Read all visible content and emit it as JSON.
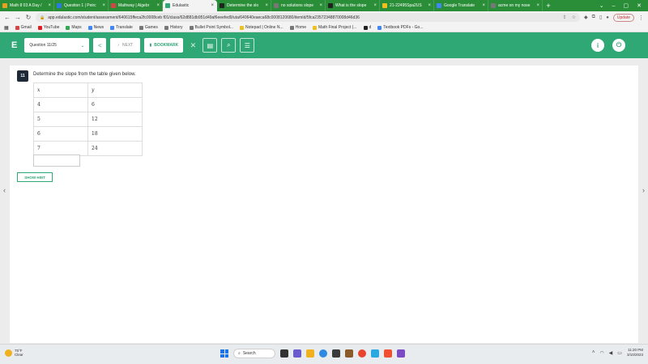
{
  "browser": {
    "tabs": [
      {
        "label": "Math 8 03 A Day /",
        "color": "#e8a020"
      },
      {
        "label": "Question 1 | Peirc",
        "color": "#2a7ae2"
      },
      {
        "label": "Mathway | Algebr",
        "color": "#d64545"
      },
      {
        "label": "Edulastic",
        "color": "#30a876"
      },
      {
        "label": "Determine the slo",
        "color": "#222222"
      },
      {
        "label": "no solutions slope",
        "color": "#777777"
      },
      {
        "label": "What is the slope",
        "color": "#222222"
      },
      {
        "label": "21-22495Spa2US",
        "color": "#f0c020"
      },
      {
        "label": "Google Translate",
        "color": "#4285f4"
      },
      {
        "label": "acme on my nose",
        "color": "#777777"
      }
    ],
    "new_tab": "+",
    "url": "app.edulastic.com/student/assessment/640615ffeca2fc0008ceb f01/class/62d881db951d49af6eeefed9/uta/640640eaeca68c0008120680/itemId/5fca23572348870008d46d36",
    "update_label": "Update",
    "bookmarks": [
      {
        "label": "Gmail",
        "color": "#d64545"
      },
      {
        "label": "YouTube",
        "color": "#e02020"
      },
      {
        "label": "Maps",
        "color": "#34a853"
      },
      {
        "label": "News",
        "color": "#4285f4"
      },
      {
        "label": "Translate",
        "color": "#4285f4"
      },
      {
        "label": "Games",
        "color": "#777777"
      },
      {
        "label": "History",
        "color": "#777777"
      },
      {
        "label": "Bullet Point Symbol...",
        "color": "#777777"
      },
      {
        "label": "Notepad | Online N...",
        "color": "#f0c020"
      },
      {
        "label": "Home",
        "color": "#777777"
      },
      {
        "label": "Math Final Project (...",
        "color": "#f0c020"
      },
      {
        "label": "d",
        "color": "#222222"
      },
      {
        "label": "Textbook PDFs - Go...",
        "color": "#4285f4"
      }
    ]
  },
  "header": {
    "logo": "E",
    "question_select": "Question 11/25",
    "prev_label": "<",
    "next_label": "NEXT",
    "bookmark_label": "BOOKMARK",
    "accent": "#30a876"
  },
  "question": {
    "number": "11",
    "prompt": "Determine the slope from the table given below.",
    "table": {
      "headers": [
        "x",
        "y"
      ],
      "rows": [
        [
          "4",
          "6"
        ],
        [
          "5",
          "12"
        ],
        [
          "6",
          "18"
        ],
        [
          "7",
          "24"
        ]
      ]
    },
    "answer_value": "",
    "hint_label": "SHOW HINT"
  },
  "taskbar": {
    "temperature": "75°F",
    "weather": "Clear",
    "search_label": "Search",
    "time": "11:20 PM",
    "date": "3/10/2023"
  }
}
